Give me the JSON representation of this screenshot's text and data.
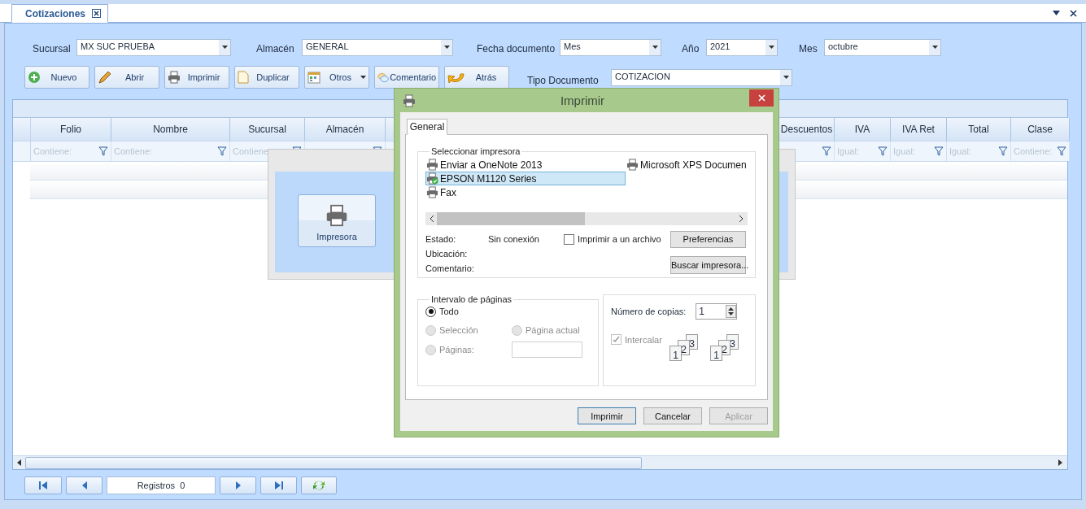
{
  "tab": {
    "label": "Cotizaciones",
    "selected": true
  },
  "filters": [
    {
      "label": "Sucursal",
      "value": "MX SUC PRUEBA"
    },
    {
      "label": "Almacén",
      "value": "GENERAL"
    },
    {
      "label": "Fecha documento",
      "value": "Mes"
    },
    {
      "label": "Año",
      "value": "2021"
    },
    {
      "label": "Mes",
      "value": "octubre"
    }
  ],
  "toolbar": [
    {
      "label": "Nuevo",
      "kind": "button"
    },
    {
      "label": "Abrir",
      "kind": "button"
    },
    {
      "label": "Imprimir",
      "kind": "button"
    },
    {
      "label": "Duplicar",
      "kind": "button"
    },
    {
      "label": "Otros",
      "kind": "dropdown"
    },
    {
      "label": "Comentario",
      "kind": "button"
    },
    {
      "label": "Atrás",
      "kind": "button"
    }
  ],
  "document_type": {
    "label": "Tipo Documento",
    "value": "COTIZACION"
  },
  "grid": {
    "left_columns": [
      {
        "label": "Folio",
        "filter": "Contiene:"
      },
      {
        "label": "Nombre",
        "filter": "Contiene:"
      },
      {
        "label": "Sucursal",
        "filter": "Contiene"
      },
      {
        "label": "Almacén"
      }
    ],
    "right_columns": [
      {
        "label": "Descuentos"
      },
      {
        "label": "IVA",
        "filter": "Igual:"
      },
      {
        "label": "IVA Ret",
        "filter": "Igual:"
      },
      {
        "label": "Total",
        "filter": "Igual:"
      },
      {
        "label": "Clase",
        "filter": "Contiene:"
      }
    ]
  },
  "pager": {
    "records": "Registros  0"
  },
  "output_panel": {
    "button": "Impresora"
  },
  "print_dialog": {
    "title": "Imprimir",
    "tab": {
      "label": "General",
      "selected": true
    },
    "printer_group": "Seleccionar impresora",
    "printers": [
      {
        "name": "Enviar a OneNote 2013",
        "selected": false,
        "default": false
      },
      {
        "name": "EPSON M1120 Series",
        "selected": true,
        "default": true
      },
      {
        "name": "Fax",
        "selected": false,
        "default": false
      },
      {
        "name": "Microsoft XPS Documen",
        "selected": false,
        "default": false
      }
    ],
    "status": [
      {
        "label": "Estado:",
        "value": "Sin conexión"
      },
      {
        "label": "Ubicación:"
      },
      {
        "label": "Comentario:"
      }
    ],
    "print_to_file": {
      "label": "Imprimir a un archivo",
      "checked": false
    },
    "side_buttons": [
      "Preferencias",
      "Buscar impresora..."
    ],
    "range_group": "Intervalo de páginas",
    "range_options": [
      {
        "label": "Todo",
        "selected": true,
        "disabled": false
      },
      {
        "label": "Selección",
        "selected": false,
        "disabled": true
      },
      {
        "label": "Página actual",
        "selected": false,
        "disabled": true
      },
      {
        "label": "Páginas:",
        "selected": false,
        "disabled": true
      }
    ],
    "copies": {
      "label": "Número de copias:",
      "value": "1"
    },
    "collate": {
      "label": "Intercalar",
      "checked": true,
      "disabled": true,
      "stacks": [
        [
          "1",
          "2",
          "3"
        ],
        [
          "1",
          "2",
          "3"
        ]
      ]
    },
    "buttons": [
      {
        "label": "Imprimir",
        "default": true,
        "disabled": false
      },
      {
        "label": "Cancelar",
        "default": false,
        "disabled": false
      },
      {
        "label": "Aplicar",
        "default": false,
        "disabled": true
      }
    ]
  }
}
